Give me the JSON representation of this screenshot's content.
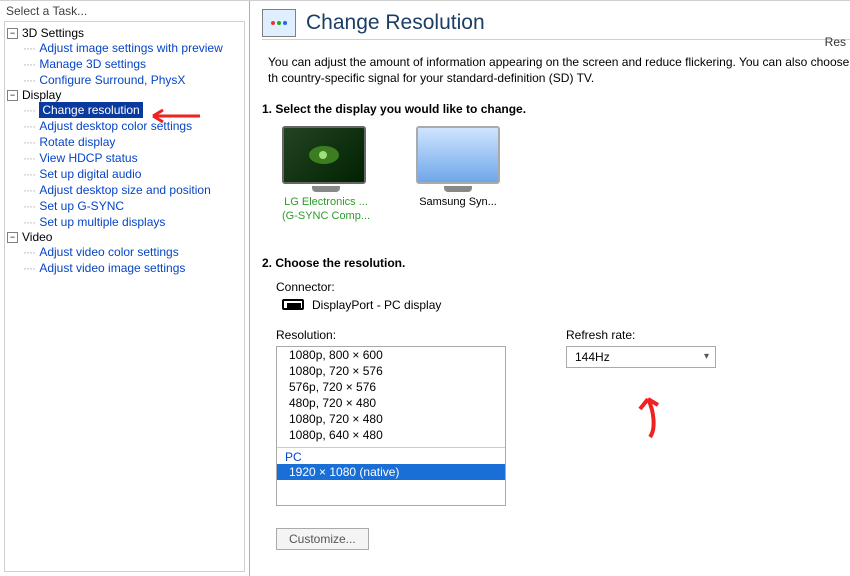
{
  "sidebar": {
    "title": "Select a Task...",
    "groups": [
      {
        "label": "3D Settings",
        "items": [
          "Adjust image settings with preview",
          "Manage 3D settings",
          "Configure Surround, PhysX"
        ]
      },
      {
        "label": "Display",
        "items": [
          "Change resolution",
          "Adjust desktop color settings",
          "Rotate display",
          "View HDCP status",
          "Set up digital audio",
          "Adjust desktop size and position",
          "Set up G-SYNC",
          "Set up multiple displays"
        ],
        "selected_index": 0
      },
      {
        "label": "Video",
        "items": [
          "Adjust video color settings",
          "Adjust video image settings"
        ]
      }
    ]
  },
  "header": {
    "title": "Change Resolution",
    "restore_text": "Res"
  },
  "description": "You can adjust the amount of information appearing on the screen and reduce flickering. You can also choose th country-specific signal for your standard-definition (SD) TV.",
  "step1": {
    "title": "1. Select the display you would like to change.",
    "displays": [
      {
        "name": "LG Electronics ...",
        "sub": "(G-SYNC Comp...",
        "primary": true
      },
      {
        "name": "Samsung Syn...",
        "sub": "",
        "primary": false
      }
    ]
  },
  "step2": {
    "title": "2. Choose the resolution.",
    "connector_label": "Connector:",
    "connector_value": "DisplayPort - PC display",
    "resolution_label": "Resolution:",
    "resolutions": [
      "1080p, 800 × 600",
      "1080p, 720 × 576",
      "576p, 720 × 576",
      "480p, 720 × 480",
      "1080p, 720 × 480",
      "1080p, 640 × 480"
    ],
    "pc_group_label": "PC",
    "pc_resolutions": [
      "1920 × 1080 (native)"
    ],
    "selected_resolution": "1920 × 1080 (native)",
    "refresh_label": "Refresh rate:",
    "refresh_value": "144Hz",
    "customize_label": "Customize..."
  }
}
